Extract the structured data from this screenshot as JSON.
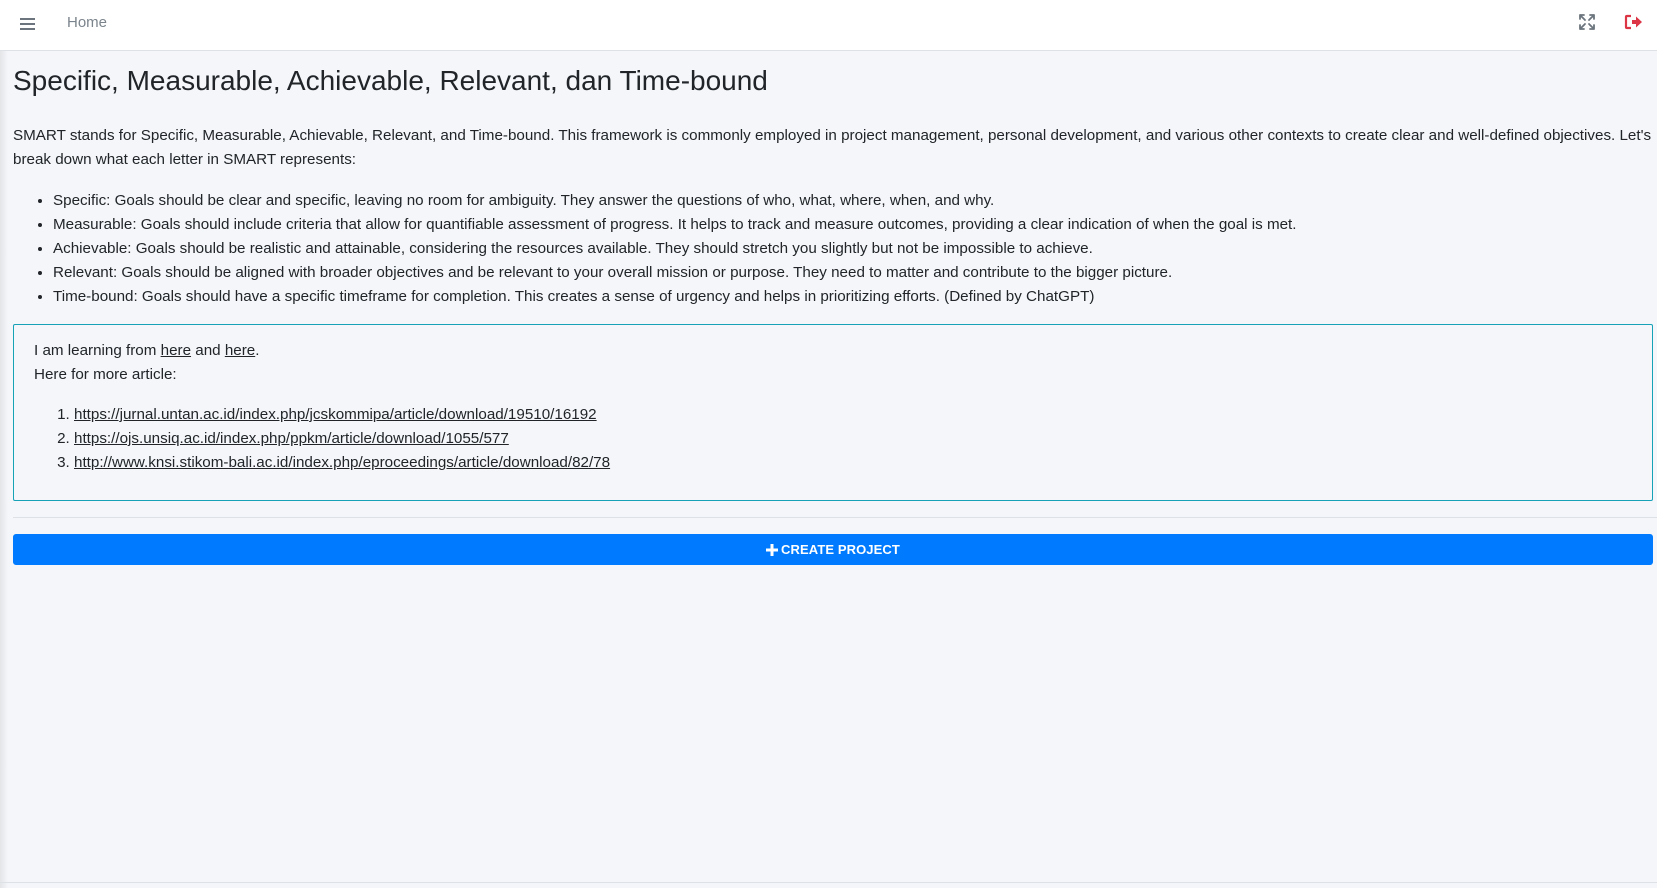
{
  "topbar": {
    "home_label": "Home",
    "menu_icon": "hamburger-menu-icon",
    "fullscreen_icon": "expand-icon",
    "logout_icon": "sign-out-icon",
    "logout_color": "#dc3545"
  },
  "main": {
    "title": "Specific, Measurable, Achievable, Relevant, dan Time-bound",
    "intro": "SMART stands for Specific, Measurable, Achievable, Relevant, and Time-bound. This framework is commonly employed in project management, personal development, and various other contexts to create clear and well-defined objectives. Let's break down what each letter in SMART represents:",
    "smart_items": [
      "Specific: Goals should be clear and specific, leaving no room for ambiguity. They answer the questions of who, what, where, when, and why.",
      "Measurable: Goals should include criteria that allow for quantifiable assessment of progress. It helps to track and measure outcomes, providing a clear indication of when the goal is met.",
      "Achievable: Goals should be realistic and attainable, considering the resources available. They should stretch you slightly but not be impossible to achieve.",
      "Relevant: Goals should be aligned with broader objectives and be relevant to your overall mission or purpose. They need to matter and contribute to the bigger picture.",
      "Time-bound: Goals should have a specific timeframe for completion. This creates a sense of urgency and helps in prioritizing efforts. (Defined by ChatGPT)"
    ]
  },
  "callout": {
    "learning_prefix": "I am learning from ",
    "link1": "here",
    "conjunction": " and ",
    "link2": "here",
    "period": ".",
    "more_label": "Here for more article:",
    "articles": [
      "https://jurnal.untan.ac.id/index.php/jcskommipa/article/download/19510/16192",
      "https://ojs.unsiq.ac.id/index.php/ppkm/article/download/1055/577",
      "http://www.knsi.stikom-bali.ac.id/index.php/eproceedings/article/download/82/78"
    ],
    "border_color": "#17a2b8"
  },
  "actions": {
    "create_label": "CREATE PROJECT",
    "create_icon": "plus-icon",
    "create_color": "#007bff"
  }
}
